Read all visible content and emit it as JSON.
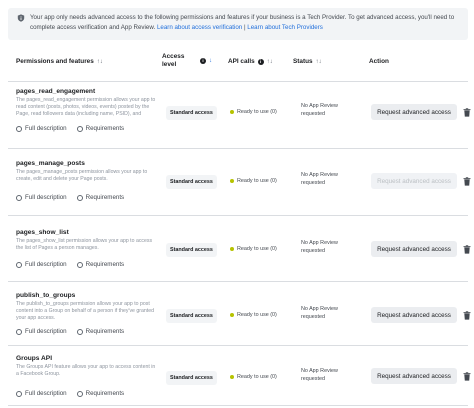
{
  "notice": {
    "text": "Your app only needs advanced access to the following permissions and features if your business is a Tech Provider. To get advanced access, you'll need to complete access verification and App Review.",
    "link1": "Learn about access verification",
    "separator": " | ",
    "link2": "Learn about Tech Providers"
  },
  "table": {
    "headers": {
      "perm": "Permissions and features",
      "access": "Access level",
      "api": "API calls",
      "status": "Status",
      "action": "Action"
    },
    "sort_icon": "↑↓",
    "sort_active_icon": "↓",
    "info_glyph": "i",
    "rows": [
      {
        "name": "pages_read_engagement",
        "desc": "The pages_read_engagement permission allows your app to read content (posts, photos, videos, events) posted by the Page, read followers data (including name, PSID), and",
        "full": "Full description",
        "req": "Requirements",
        "access": "Standard access",
        "api": "Ready to use (0)",
        "status": "No App Review requested",
        "button": "Request advanced access",
        "enabled": true
      },
      {
        "name": "pages_manage_posts",
        "desc": "The pages_manage_posts permission allows your app to create, edit and delete your Page posts.",
        "full": "Full description",
        "req": "Requirements",
        "access": "Standard access",
        "api": "Ready to use (0)",
        "status": "No App Review requested",
        "button": "Request advanced access",
        "enabled": false
      },
      {
        "name": "pages_show_list",
        "desc": "The pages_show_list permission allows your app to access the list of Pages a person manages.",
        "full": "Full description",
        "req": "Requirements",
        "access": "Standard access",
        "api": "Ready to use (0)",
        "status": "No App Review requested",
        "button": "Request advanced access",
        "enabled": true
      },
      {
        "name": "publish_to_groups",
        "desc": "The publish_to_groups permission allows your app to post content into a Group on behalf of a person if they've granted your app access.",
        "full": "Full description",
        "req": "Requirements",
        "access": "Standard access",
        "api": "Ready to use (0)",
        "status": "No App Review requested",
        "button": "Request advanced access",
        "enabled": true
      },
      {
        "name": "Groups API",
        "desc": "The Groups API feature allows your app to access content in a Facebook Group.",
        "full": "Full description",
        "req": "Requirements",
        "access": "Standard access",
        "api": "Ready to use (0)",
        "status": "No App Review requested",
        "button": "Request advanced access",
        "enabled": true
      }
    ]
  }
}
